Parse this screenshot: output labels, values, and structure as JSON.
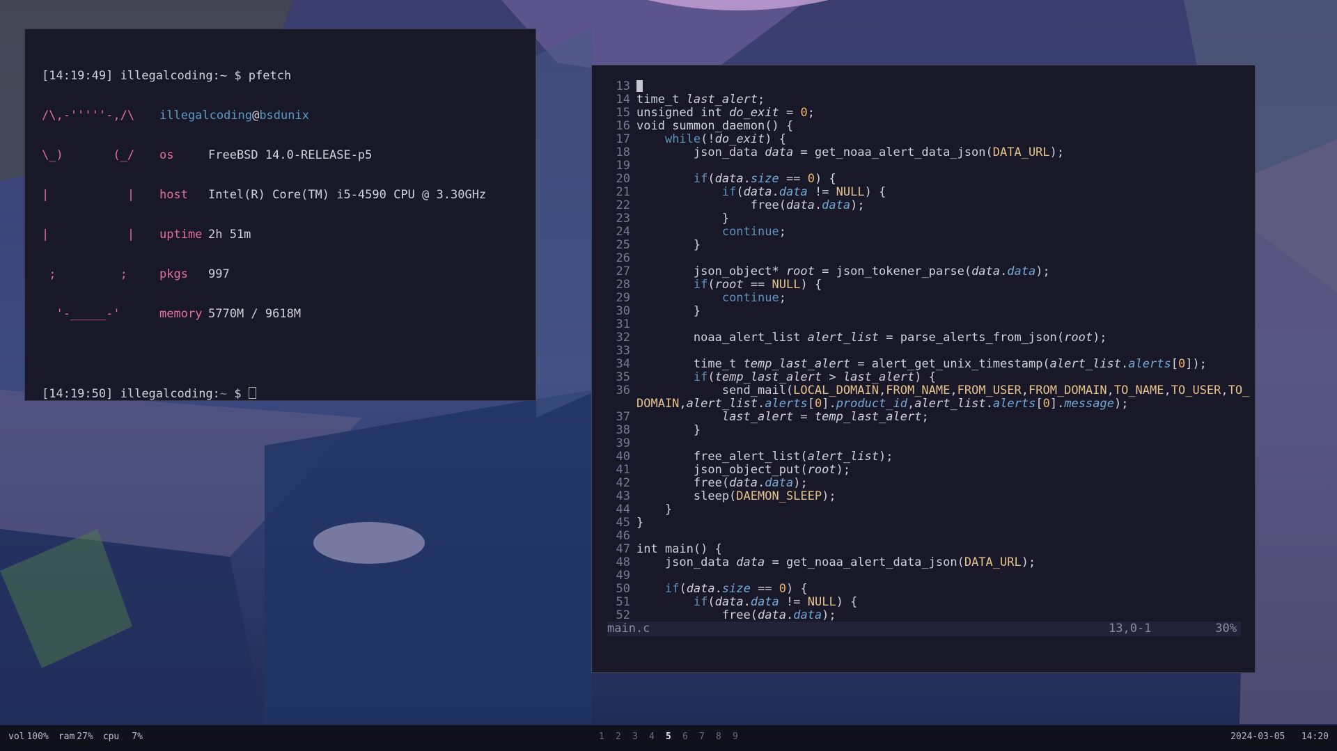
{
  "terminal": {
    "line1": "[14:19:49] illegalcoding:~ $ pfetch",
    "prompt2_time": "[14:19:50]",
    "prompt2_user": "illegalcoding:",
    "prompt2_dir": "~",
    "prompt2_sym": " $ ",
    "fetch": {
      "user": "illegalcoding",
      "at": "@",
      "host": "bsdunix",
      "art": [
        "/\\,-'''''-,/\\",
        "\\_)       (_/",
        "|           |",
        "|           |",
        " ;         ;",
        "  '-_____-'"
      ],
      "rows": [
        {
          "key": "os",
          "value": "FreeBSD 14.0-RELEASE-p5"
        },
        {
          "key": "host",
          "value": "Intel(R) Core(TM) i5-4590 CPU @ 3.30GHz"
        },
        {
          "key": "uptime",
          "value": "2h 51m"
        },
        {
          "key": "pkgs",
          "value": "997"
        },
        {
          "key": "memory",
          "value": "5770M / 9618M"
        }
      ]
    }
  },
  "editor": {
    "filename": "main.c",
    "position": "13,0-1",
    "percent": "30%",
    "line_numbers": [
      "13",
      "14",
      "15",
      "16",
      "17",
      "18",
      "19",
      "20",
      "21",
      "22",
      "23",
      "24",
      "25",
      "26",
      "27",
      "28",
      "29",
      "30",
      "31",
      "32",
      "33",
      "34",
      "35",
      "36",
      "",
      "37",
      "38",
      "39",
      "40",
      "41",
      "42",
      "43",
      "44",
      "45",
      "46",
      "47",
      "48",
      "49",
      "50",
      "51",
      "52"
    ]
  },
  "bar": {
    "vol_label": "vol",
    "vol": "100%",
    "ram_label": "ram",
    "ram": "27%",
    "cpu_label": "cpu",
    "cpu": "7%",
    "workspaces": [
      "1",
      "2",
      "3",
      "4",
      "5",
      "6",
      "7",
      "8",
      "9"
    ],
    "active_workspace": "5",
    "date": "2024-03-05",
    "time": "14:20"
  }
}
